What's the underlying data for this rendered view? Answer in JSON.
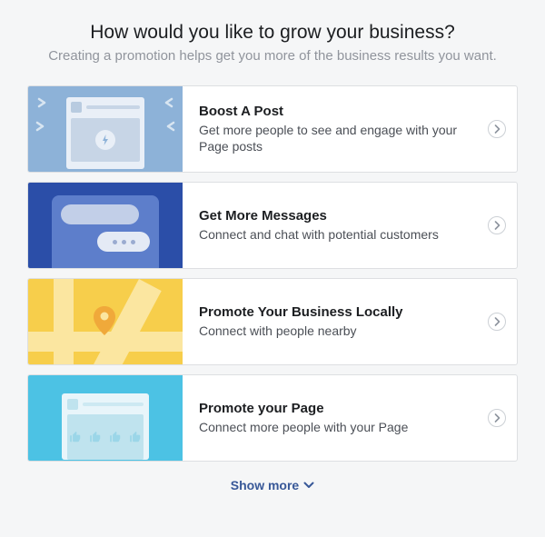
{
  "header": {
    "title": "How would you like to grow your business?",
    "subtitle": "Creating a promotion helps get you more of the business results you want."
  },
  "options": [
    {
      "title": "Boost A Post",
      "desc": "Get more people to see and engage with your Page posts"
    },
    {
      "title": "Get More Messages",
      "desc": "Connect and chat with potential customers"
    },
    {
      "title": "Promote Your Business Locally",
      "desc": "Connect with people nearby"
    },
    {
      "title": "Promote your Page",
      "desc": "Connect more people with your Page"
    }
  ],
  "footer": {
    "show_more": "Show more"
  }
}
